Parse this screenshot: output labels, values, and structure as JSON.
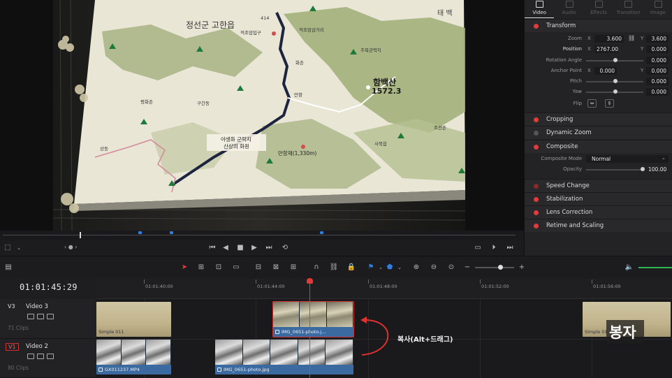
{
  "viewer": {
    "map": {
      "county": "정선군 고한읍",
      "peak_name": "함백산",
      "peak_height": "1572.3",
      "site_line1": "야생화 군락지",
      "site_line2": "산상의 화원",
      "pass": "만항재(1,330m)",
      "right_label": "태 백",
      "lbl_a": "적조암입구",
      "lbl_b": "적조암삼거리",
      "lbl_c": "주목군락지",
      "lbl_d": "평화촌",
      "lbl_e": "구간동",
      "lbl_f": "사북읍",
      "lbl_g": "조전촌",
      "lbl_h": "만항",
      "lbl_i": "화촌",
      "lbl_j": "상동",
      "route_no": "414"
    }
  },
  "transport": {
    "zoom_indicator": "‹ ● ›"
  },
  "inspector": {
    "tabs": [
      "Video",
      "Audio",
      "Effects",
      "Transition",
      "Image"
    ],
    "active_tab": "Video",
    "sections": {
      "transform": "Transform",
      "cropping": "Cropping",
      "dynamic_zoom": "Dynamic Zoom",
      "composite": "Composite",
      "speed_change": "Speed Change",
      "stabilization": "Stabilization",
      "lens_correction": "Lens Correction",
      "retime_scaling": "Retime and Scaling"
    },
    "params": {
      "zoom": {
        "label": "Zoom",
        "x_axis": "X",
        "y_axis": "Y",
        "x": "3.600",
        "y": "3.600"
      },
      "position": {
        "label": "Position",
        "x_axis": "X",
        "y_axis": "Y",
        "x": "2767.000",
        "y": "0.000"
      },
      "rotation": {
        "label": "Rotation Angle",
        "value": "0.000"
      },
      "anchor": {
        "label": "Anchor Point",
        "x_axis": "X",
        "y_axis": "Y",
        "x": "0.000",
        "y": "0.000"
      },
      "pitch": {
        "label": "Pitch",
        "value": "0.000"
      },
      "yaw": {
        "label": "Yaw",
        "value": "0.000"
      },
      "flip": {
        "label": "Flip"
      },
      "composite_mode": {
        "label": "Composite Mode",
        "value": "Normal"
      },
      "opacity": {
        "label": "Opacity",
        "value": "100.00"
      }
    }
  },
  "timeline": {
    "timecode": "01:01:45:29",
    "ruler": [
      "01:01:40:00",
      "01:01:44:00",
      "01:01:48:00",
      "01:01:52:00",
      "01:01:56:00"
    ],
    "tracks": [
      {
        "id": "V3",
        "name": "Video 3",
        "count": "71 Clips"
      },
      {
        "id": "V1",
        "name": "Video 2",
        "count": "80 Clips"
      }
    ],
    "clips": {
      "v3_a": "Simple 011",
      "v3_b": "IMG_0651-photo.j...",
      "v3_c": "Simple 01",
      "v2_a": "GX011237.MP4",
      "v2_b": "IMG_0651-photo.jpg"
    }
  },
  "annotation": "복사(Alt+드래그)",
  "subtitle": "봉자",
  "colors": {
    "accent_red": "#e03a3a",
    "clip_blue": "#3a6aa0",
    "marker_blue": "#2f7fe0"
  }
}
